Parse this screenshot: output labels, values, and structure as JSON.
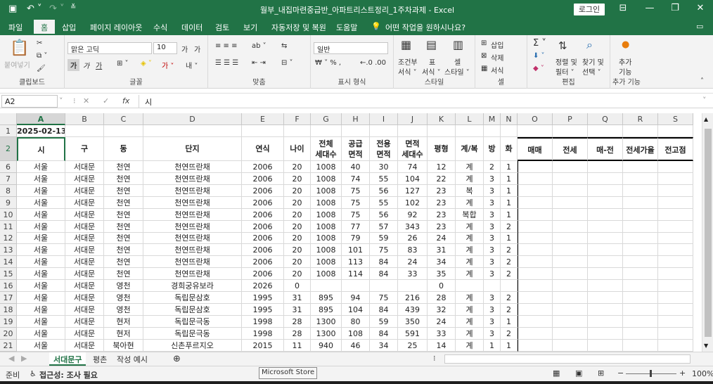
{
  "window": {
    "title": "월부_내집마련중급반_아파트리스트정리_1주차과제  -  Excel",
    "login": "로그인"
  },
  "tabs": [
    "파일",
    "홈",
    "삽입",
    "페이지 레이아웃",
    "수식",
    "데이터",
    "검토",
    "보기",
    "자동저장 및 복원",
    "도움말"
  ],
  "tell_me": "어떤 작업을 원하시나요?",
  "ribbon": {
    "clipboard": {
      "label": "클립보드",
      "paste": "붙여넣기"
    },
    "font": {
      "label": "글꼴",
      "name": "맑은 고딕",
      "size": "10",
      "bold": "가",
      "italic": "가",
      "underline": "가",
      "grow": "가",
      "shrink": "가"
    },
    "align": {
      "label": "맞춤"
    },
    "number": {
      "label": "표시 형식",
      "format": "일반"
    },
    "styles": {
      "label": "스타일",
      "cond": "조건부",
      "cond2": "서식 ˅",
      "table": "표",
      "table2": "서식 ˅",
      "cell": "셀",
      "cell2": "스타일 ˅"
    },
    "cells": {
      "label": "셀",
      "insert": "삽입",
      "delete": "삭제",
      "format": "서식"
    },
    "edit": {
      "label": "편집",
      "sort": "정렬 및",
      "sort2": "필터 ˅",
      "find": "찾기 및",
      "find2": "선택 ˅"
    },
    "addins": {
      "label": "추가 기능",
      "btn": "추가",
      "btn2": "기능"
    }
  },
  "formula_bar": {
    "name_box": "A2",
    "fx": "fx",
    "value": "시"
  },
  "columns": [
    "A",
    "B",
    "C",
    "D",
    "E",
    "F",
    "G",
    "H",
    "I",
    "J",
    "K",
    "L",
    "M",
    "N",
    "O",
    "P",
    "Q",
    "R",
    "S"
  ],
  "row1": {
    "rownum": "1",
    "A": "2025-02-13"
  },
  "header_row": {
    "rownum": "2",
    "cells": [
      "시",
      "구",
      "동",
      "단지",
      "연식",
      "나이",
      "전체\n세대수",
      "공급\n면적",
      "전용\n면적",
      "면적\n세대수",
      "평형",
      "계/복",
      "방",
      "화",
      "매매",
      "전세",
      "매-전",
      "전세가율",
      "전고점"
    ]
  },
  "rows": [
    [
      "6",
      "서울",
      "서대문",
      "천연",
      "천연뜨란채",
      "2006",
      "20",
      "1008",
      "40",
      "30",
      "74",
      "12",
      "계",
      "2",
      "1"
    ],
    [
      "7",
      "서울",
      "서대문",
      "천연",
      "천연뜨란채",
      "2006",
      "20",
      "1008",
      "74",
      "55",
      "104",
      "22",
      "계",
      "3",
      "1"
    ],
    [
      "8",
      "서울",
      "서대문",
      "천연",
      "천연뜨란채",
      "2006",
      "20",
      "1008",
      "75",
      "56",
      "127",
      "23",
      "복",
      "3",
      "1"
    ],
    [
      "9",
      "서울",
      "서대문",
      "천연",
      "천연뜨란채",
      "2006",
      "20",
      "1008",
      "75",
      "55",
      "102",
      "23",
      "계",
      "3",
      "1"
    ],
    [
      "10",
      "서울",
      "서대문",
      "천연",
      "천연뜨란채",
      "2006",
      "20",
      "1008",
      "75",
      "56",
      "92",
      "23",
      "복합",
      "3",
      "1"
    ],
    [
      "11",
      "서울",
      "서대문",
      "천연",
      "천연뜨란채",
      "2006",
      "20",
      "1008",
      "77",
      "57",
      "343",
      "23",
      "계",
      "3",
      "2"
    ],
    [
      "12",
      "서울",
      "서대문",
      "천연",
      "천연뜨란채",
      "2006",
      "20",
      "1008",
      "79",
      "59",
      "26",
      "24",
      "계",
      "3",
      "1"
    ],
    [
      "13",
      "서울",
      "서대문",
      "천연",
      "천연뜨란채",
      "2006",
      "20",
      "1008",
      "101",
      "75",
      "83",
      "31",
      "계",
      "3",
      "2"
    ],
    [
      "14",
      "서울",
      "서대문",
      "천연",
      "천연뜨란채",
      "2006",
      "20",
      "1008",
      "113",
      "84",
      "24",
      "34",
      "계",
      "3",
      "2"
    ],
    [
      "15",
      "서울",
      "서대문",
      "천연",
      "천연뜨란채",
      "2006",
      "20",
      "1008",
      "114",
      "84",
      "33",
      "35",
      "계",
      "3",
      "2"
    ],
    [
      "16",
      "서울",
      "서대문",
      "영천",
      "경희궁유보라",
      "2026",
      "0",
      "",
      "",
      "",
      "",
      "0",
      "",
      "",
      ""
    ],
    [
      "17",
      "서울",
      "서대문",
      "영천",
      "독립문삼호",
      "1995",
      "31",
      "895",
      "94",
      "75",
      "216",
      "28",
      "계",
      "3",
      "2"
    ],
    [
      "18",
      "서울",
      "서대문",
      "영천",
      "독립문삼호",
      "1995",
      "31",
      "895",
      "104",
      "84",
      "439",
      "32",
      "계",
      "3",
      "2"
    ],
    [
      "19",
      "서울",
      "서대문",
      "현저",
      "독립문극동",
      "1998",
      "28",
      "1300",
      "80",
      "59",
      "350",
      "24",
      "계",
      "3",
      "1"
    ],
    [
      "20",
      "서울",
      "서대문",
      "현저",
      "독립문극동",
      "1998",
      "28",
      "1300",
      "108",
      "84",
      "591",
      "33",
      "계",
      "3",
      "2"
    ],
    [
      "21",
      "서울",
      "서대문",
      "북아현",
      "신촌푸르지오",
      "2015",
      "11",
      "940",
      "46",
      "34",
      "25",
      "14",
      "계",
      "1",
      "1"
    ]
  ],
  "sheets": [
    "서대문구",
    "평촌",
    "작성 예시"
  ],
  "status": {
    "ready": "준비",
    "access": "접근성: 조사 필요",
    "zoom": "100%"
  },
  "tooltip": "Microsoft Store"
}
